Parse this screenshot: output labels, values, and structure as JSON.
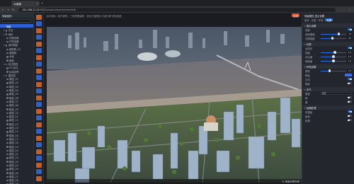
{
  "browser": {
    "tab_title": "3d编辑",
    "url_host": "192.168.11.22",
    "url_path": ":8080/project/layer/scene/edit",
    "new_tab": "+"
  },
  "left_tree": {
    "title": "场景结构",
    "items": [
      {
        "label": "场景",
        "selected": true,
        "indent": 0
      },
      {
        "label": "天空",
        "indent": 1
      },
      {
        "label": "地形",
        "indent": 1
      },
      {
        "label": "光照设置",
        "indent": 2
      },
      {
        "label": "环境设置",
        "indent": 2
      },
      {
        "label": "城市模型",
        "indent": 1
      },
      {
        "label": "建筑群_01",
        "indent": 2
      },
      {
        "label": "道路网",
        "indent": 2
      },
      {
        "label": "水面",
        "indent": 2
      },
      {
        "label": "植被",
        "indent": 2
      },
      {
        "label": "标注图层",
        "indent": 1
      },
      {
        "label": "POI点位",
        "indent": 2
      },
      {
        "label": "区域边界",
        "indent": 2
      },
      {
        "label": "图层组",
        "indent": 1
      },
      {
        "label": "模型_01",
        "indent": 2
      },
      {
        "label": "模型_02",
        "indent": 2
      },
      {
        "label": "模型_03",
        "indent": 2
      },
      {
        "label": "模型_04",
        "indent": 2
      },
      {
        "label": "模型_05",
        "indent": 2
      },
      {
        "label": "模型_06",
        "indent": 2
      },
      {
        "label": "模型_07",
        "indent": 2
      },
      {
        "label": "模型_08",
        "indent": 2
      },
      {
        "label": "模型_09",
        "indent": 2
      },
      {
        "label": "模型_10",
        "indent": 2
      },
      {
        "label": "模型_11",
        "indent": 2
      },
      {
        "label": "模型_12",
        "indent": 2
      },
      {
        "label": "模型_13",
        "indent": 2
      },
      {
        "label": "模型_14",
        "indent": 2
      },
      {
        "label": "模型_15",
        "indent": 2
      },
      {
        "label": "模型_16",
        "indent": 2
      },
      {
        "label": "模型_17",
        "indent": 2
      },
      {
        "label": "模型_18",
        "indent": 2
      },
      {
        "label": "模型_19",
        "indent": 2
      },
      {
        "label": "模型_20",
        "indent": 2
      },
      {
        "label": "模型_21",
        "indent": 2
      },
      {
        "label": "模型_22",
        "indent": 2
      },
      {
        "label": "模型_23",
        "indent": 2
      },
      {
        "label": "模型_24",
        "indent": 2
      },
      {
        "label": "模型_25",
        "indent": 2
      },
      {
        "label": "模型_26",
        "indent": 2
      },
      {
        "label": "模型_27",
        "indent": 2
      },
      {
        "label": "模型_28",
        "indent": 2
      },
      {
        "label": "模型_29",
        "indent": 2
      }
    ]
  },
  "toolbar": {
    "icon_colors": [
      "#e8702e",
      "#3a71e6",
      "#e8702e",
      "#3a71e6",
      "#e8702e",
      "#3a71e6",
      "#e8702e",
      "#3a71e6",
      "#e8702e",
      "#3a71e6",
      "#e8702e",
      "#3a71e6",
      "#e8702e",
      "#3a71e6",
      "#e8702e",
      "#3a71e6",
      "#e8702e",
      "#3a71e6",
      "#e8702e",
      "#3a71e6",
      "#e8702e",
      "#3a71e6",
      "#e8702e",
      "#3a71e6",
      "#e8702e"
    ]
  },
  "canvas": {
    "breadcrumb": "当前场景 / 城市建筑 / 三维视图编辑 · 鼠标左键旋转 右键平移 滚轮缩放",
    "publish_label": "发布",
    "status": "© 场景加载完成"
  },
  "right_panel": {
    "title": "场景属性  显示设置",
    "tabs": [
      {
        "label": "基本",
        "on": false
      },
      {
        "label": "光照",
        "on": false
      },
      {
        "label": "环境",
        "on": false
      },
      {
        "label": "效果",
        "on": true
      }
    ],
    "sections": [
      {
        "title": "显示设置",
        "rows": [
          {
            "label": "背景",
            "type": "toggle",
            "on": true
          },
          {
            "label": "地球透明",
            "type": "slider",
            "value": 0.7,
            "num": "70"
          },
          {
            "label": "光照强度",
            "type": "slider",
            "value": 0.45,
            "num": "45"
          }
        ]
      },
      {
        "title": "光照",
        "rows": [
          {
            "label": "太阳光",
            "type": "toggle",
            "on": true
          },
          {
            "label": "亮度",
            "type": "slider",
            "value": 0.55,
            "num": "1.0"
          },
          {
            "label": "对比度",
            "type": "slider",
            "value": 0.5,
            "num": "1.0"
          },
          {
            "label": "饱和度",
            "type": "slider",
            "value": 0.5,
            "num": "1.0"
          }
        ]
      },
      {
        "title": "环境设置",
        "rows": [
          {
            "label": "雾效",
            "type": "slider",
            "value": 0.35,
            "num": "0.3"
          },
          {
            "label": "颜色",
            "type": "swatch"
          },
          {
            "label": "泛光",
            "type": "toggle",
            "on": true
          },
          {
            "label": "阴影",
            "type": "toggle",
            "on": false
          }
        ]
      },
      {
        "title": "天气",
        "rows": [
          {
            "label": "类型",
            "type": "select",
            "value": "晴天"
          },
          {
            "label": "雨",
            "type": "toggle",
            "on": false
          },
          {
            "label": "雪",
            "type": "toggle",
            "on": false
          }
        ]
      },
      {
        "title": "后期处理",
        "rows": [
          {
            "label": "抗锯齿",
            "type": "toggle",
            "on": true
          },
          {
            "label": "景深",
            "type": "toggle",
            "on": false
          },
          {
            "label": "色调",
            "type": "toggle",
            "on": false
          }
        ]
      }
    ]
  }
}
